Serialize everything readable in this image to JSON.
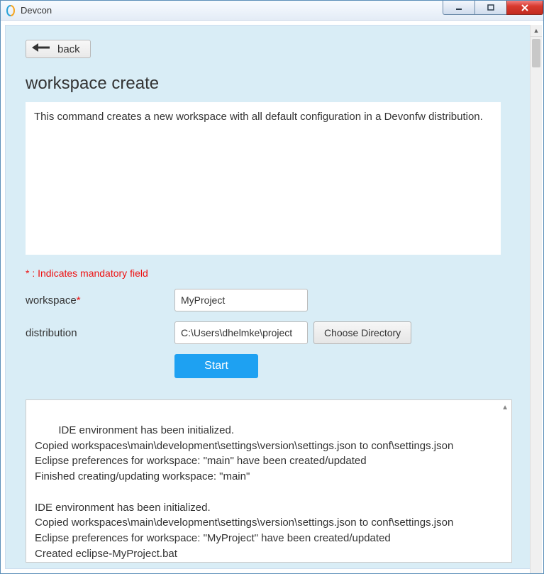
{
  "window": {
    "title": "Devcon"
  },
  "page": {
    "back_label": "back",
    "title": "workspace create",
    "description": "This command creates a new workspace with all default configuration in a Devonfw distribution.",
    "mandatory_note": "* : Indicates mandatory field"
  },
  "form": {
    "workspace_label": "workspace",
    "workspace_value": "MyProject",
    "distribution_label": "distribution",
    "distribution_value": "C:\\Users\\dhelmke\\project",
    "choose_dir_label": "Choose Directory",
    "start_label": "Start"
  },
  "output": "IDE environment has been initialized.\nCopied workspaces\\main\\development\\settings\\version\\settings.json to conf\\settings.json\nEclipse preferences for workspace: \"main\" have been created/updated\nFinished creating/updating workspace: \"main\"\n\nIDE environment has been initialized.\nCopied workspaces\\main\\development\\settings\\version\\settings.json to conf\\settings.json\nEclipse preferences for workspace: \"MyProject\" have been created/updated\nCreated eclipse-MyProject.bat"
}
